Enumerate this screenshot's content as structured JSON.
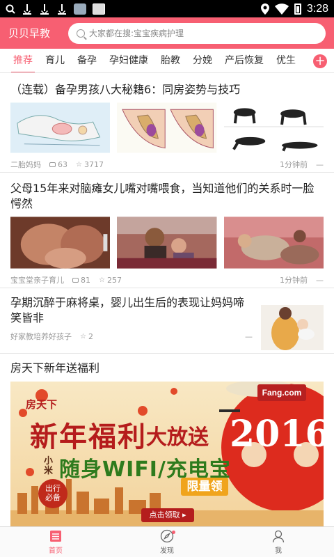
{
  "status_bar": {
    "time": "3:28",
    "icons": [
      "search-icon",
      "download-icon",
      "download-icon",
      "download-icon",
      "app-icon",
      "app-icon",
      "location-icon",
      "wifi-icon",
      "battery-icon"
    ]
  },
  "header": {
    "brand": "贝贝早教",
    "search_placeholder": "大家都在搜:宝宝疾病护理",
    "bg_color": "#f75f72"
  },
  "tabs": [
    {
      "label": "推荐",
      "active": true
    },
    {
      "label": "育儿"
    },
    {
      "label": "备孕"
    },
    {
      "label": "孕妇健康"
    },
    {
      "label": "胎教"
    },
    {
      "label": "分娩"
    },
    {
      "label": "产后恢复"
    },
    {
      "label": "优生"
    }
  ],
  "tab_add": "+",
  "articles": [
    {
      "title": "（连载）备孕男孩八大秘籍6：同房姿势与技巧",
      "source": "二胎妈妈",
      "comments": "63",
      "likes": "3717",
      "time": "1分钟前",
      "more": "—"
    },
    {
      "title": "父母15年来对脑瘫女儿嘴对嘴喂食，当知道他们的关系时一脸愕然",
      "source": "宝宝堂亲子育儿",
      "comments": "81",
      "likes": "257",
      "time": "1分钟前",
      "more": "—"
    },
    {
      "title": "孕期沉醉于麻将桌，婴儿出生后的表现让妈妈啼笑皆非",
      "source": "好家教培养好孩子",
      "likes": "2",
      "more": "—"
    },
    {
      "title": "房天下新年送福利"
    }
  ],
  "banner": {
    "brand_cn": "房天下",
    "logo": "Fang.com",
    "logo_small": "房天下",
    "headline": "新年福利",
    "headline2": "大放送",
    "product_prefix": "小米",
    "product": "随身WIFI/充电宝",
    "limited": "限量领",
    "badge_line1": "出行",
    "badge_line2": "必备",
    "year": "2016",
    "cta": "点击领取 ▸"
  },
  "bottom_nav": [
    {
      "label": "首页",
      "icon": "home-icon",
      "active": true
    },
    {
      "label": "发现",
      "icon": "compass-icon"
    },
    {
      "label": "我",
      "icon": "user-icon"
    }
  ]
}
